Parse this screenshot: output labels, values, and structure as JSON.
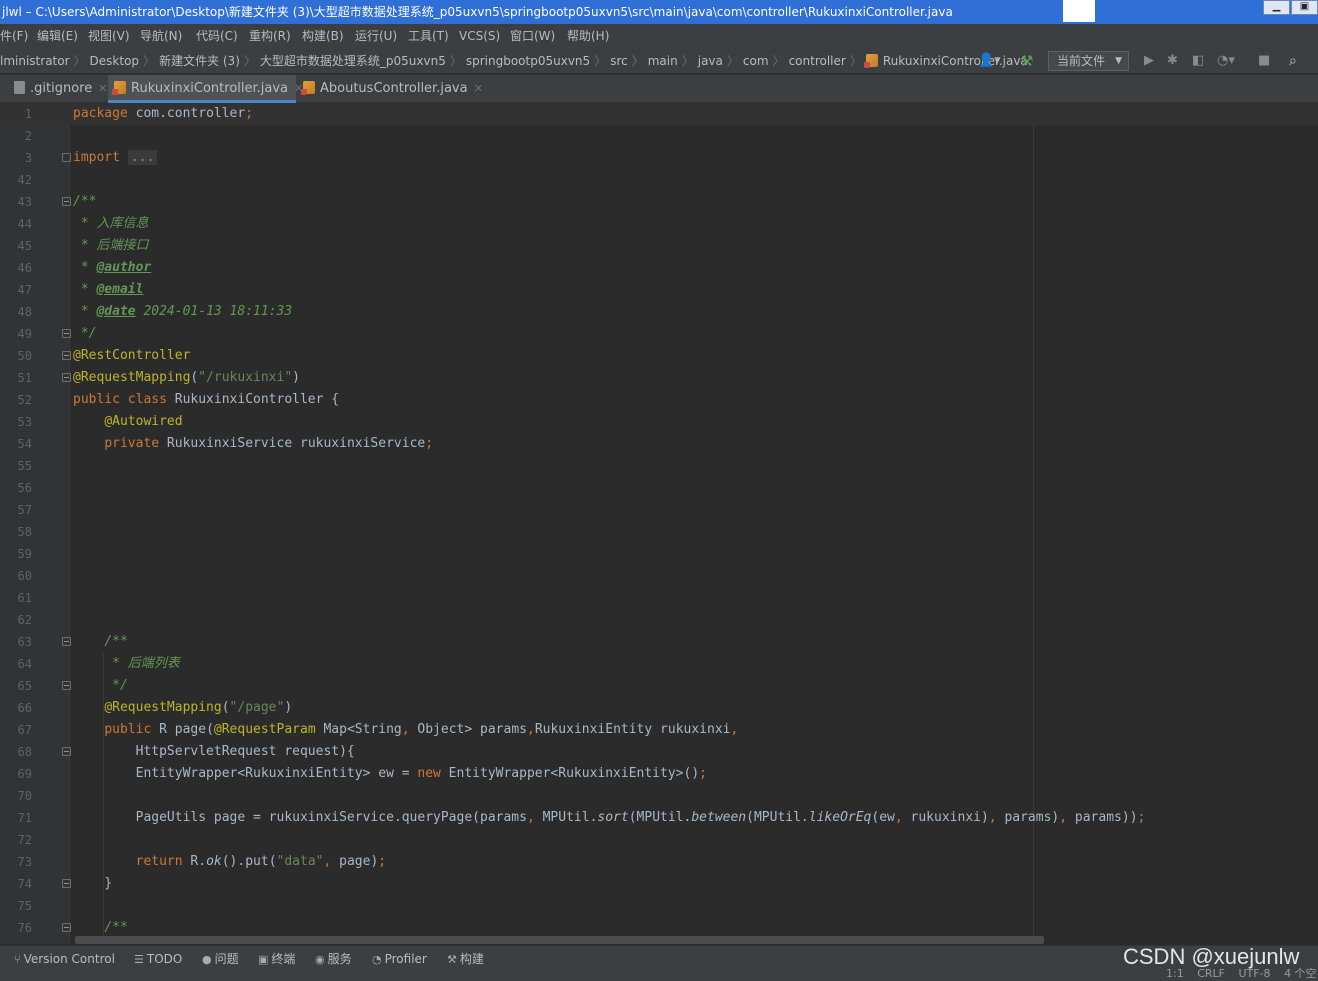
{
  "window": {
    "title": "jlwl – C:\\Users\\Administrator\\Desktop\\新建文件夹 (3)\\大型超市数据处理系统_p05uxvn5\\springbootp05uxvn5\\src\\main\\java\\com\\controller\\RukuxinxiController.java",
    "minimize": "▁",
    "restore": "▣"
  },
  "menu": [
    "件(F)",
    "编辑(E)",
    "视图(V)",
    "导航(N)",
    "代码(C)",
    "重构(R)",
    "构建(B)",
    "运行(U)",
    "工具(T)",
    "VCS(S)",
    "窗口(W)",
    "帮助(H)"
  ],
  "breadcrumbs": [
    "lministrator",
    "Desktop",
    "新建文件夹 (3)",
    "大型超市数据处理系统_p05uxvn5",
    "springbootp05uxvn5",
    "src",
    "main",
    "java",
    "com",
    "controller",
    "RukuxinxiController.java"
  ],
  "toolbar": {
    "run_config": "当前文件",
    "user_icon": "person-icon",
    "build_icon": "hammer-icon",
    "run_icon": "run-icon",
    "debug_icon": "debug-icon",
    "coverage_icon": "coverage-icon",
    "profile_icon": "profile-icon",
    "stop_icon": "stop-icon",
    "search_icon": "search-icon"
  },
  "tabs": [
    {
      "label": ".gitignore",
      "active": false
    },
    {
      "label": "RukuxinxiController.java",
      "active": true
    },
    {
      "label": "AboutusController.java",
      "active": false
    }
  ],
  "editor": {
    "lines": [
      {
        "n": "1",
        "html": "<span class=\"kw\">package</span> com.controller<span class=\"kw\">;</span>",
        "current": true
      },
      {
        "n": "2",
        "html": ""
      },
      {
        "n": "3",
        "html": "<span class=\"kw\">import</span> <span class=\"folded\">...</span>",
        "fold": "closed"
      },
      {
        "n": "42",
        "html": ""
      },
      {
        "n": "43",
        "html": "<span class=\"doc\">/**</span>",
        "fold": "open"
      },
      {
        "n": "44",
        "html": "<span class=\"doc\"> * 入库信息</span>"
      },
      {
        "n": "45",
        "html": "<span class=\"doc\"> * 后端接口</span>"
      },
      {
        "n": "46",
        "html": "<span class=\"doc\"> * </span><span class=\"tag\">@author</span>"
      },
      {
        "n": "47",
        "html": "<span class=\"doc\"> * </span><span class=\"tag\">@email</span>"
      },
      {
        "n": "48",
        "html": "<span class=\"doc\"> * </span><span class=\"tag\">@date</span><span class=\"doc\"> 2024-01-13 18:11:33</span>"
      },
      {
        "n": "49",
        "html": "<span class=\"doc\"> */</span>",
        "fold": "open"
      },
      {
        "n": "50",
        "html": "<span class=\"ann\">@RestController</span>",
        "fold": "open"
      },
      {
        "n": "51",
        "html": "<span class=\"ann\">@RequestMapping</span>(<span class=\"str\">\"/rukuxinxi\"</span>)",
        "fold": "open"
      },
      {
        "n": "52",
        "html": "<span class=\"kw\">public class</span> RukuxinxiController {"
      },
      {
        "n": "53",
        "html": "    <span class=\"ann\">@Autowired</span>"
      },
      {
        "n": "54",
        "html": "    <span class=\"kw\">private</span> RukuxinxiService rukuxinxiService<span class=\"kw\">;</span>"
      },
      {
        "n": "55",
        "html": ""
      },
      {
        "n": "56",
        "html": ""
      },
      {
        "n": "57",
        "html": ""
      },
      {
        "n": "58",
        "html": ""
      },
      {
        "n": "59",
        "html": ""
      },
      {
        "n": "60",
        "html": ""
      },
      {
        "n": "61",
        "html": ""
      },
      {
        "n": "62",
        "html": ""
      },
      {
        "n": "63",
        "html": "    <span class=\"doc\">/**</span>",
        "fold": "open"
      },
      {
        "n": "64",
        "html": "<span class=\"doc\">     * 后端列表</span>"
      },
      {
        "n": "65",
        "html": "<span class=\"doc\">     */</span>",
        "fold": "open"
      },
      {
        "n": "66",
        "html": "    <span class=\"ann\">@RequestMapping</span>(<span class=\"str\">\"/page\"</span>)"
      },
      {
        "n": "67",
        "html": "    <span class=\"kw\">public</span> R page(<span class=\"ann\">@RequestParam</span> Map&lt;String<span class=\"kw\">,</span> Object&gt; params<span class=\"kw\">,</span>RukuxinxiEntity rukuxinxi<span class=\"kw\">,</span>"
      },
      {
        "n": "68",
        "html": "        HttpServletRequest request){",
        "fold": "open"
      },
      {
        "n": "69",
        "html": "        EntityWrapper&lt;RukuxinxiEntity&gt; ew = <span class=\"kw\">new</span> EntityWrapper&lt;RukuxinxiEntity&gt;()<span class=\"kw\">;</span>"
      },
      {
        "n": "70",
        "html": ""
      },
      {
        "n": "71",
        "html": "        PageUtils page = rukuxinxiService.queryPage(params<span class=\"kw\">,</span> MPUtil.<i>sort</i>(MPUtil.<i>between</i>(MPUtil.<i>likeOrEq</i>(ew<span class=\"kw\">,</span> rukuxinxi)<span class=\"kw\">,</span> params)<span class=\"kw\">,</span> params))<span class=\"kw\">;</span>"
      },
      {
        "n": "72",
        "html": ""
      },
      {
        "n": "73",
        "html": "        <span class=\"kw\">return</span> R.<i>ok</i>().put(<span class=\"str\">\"data\"</span><span class=\"kw\">,</span> page)<span class=\"kw\">;</span>"
      },
      {
        "n": "74",
        "html": "    }",
        "fold": "open"
      },
      {
        "n": "75",
        "html": ""
      },
      {
        "n": "76",
        "html": "    <span class=\"doc\">/**</span>",
        "fold": "open"
      }
    ]
  },
  "statusbar": {
    "tools": [
      {
        "icon": "version-control-icon",
        "glyph": "⑂",
        "label": "Version Control"
      },
      {
        "icon": "todo-icon",
        "glyph": "☰",
        "label": "TODO"
      },
      {
        "icon": "problems-icon",
        "glyph": "●",
        "label": "问题"
      },
      {
        "icon": "terminal-icon",
        "glyph": "▣",
        "label": "终端"
      },
      {
        "icon": "services-icon",
        "glyph": "◉",
        "label": "服务"
      },
      {
        "icon": "profiler-icon",
        "glyph": "◔",
        "label": "Profiler"
      },
      {
        "icon": "build-icon",
        "glyph": "⚒",
        "label": "构建"
      }
    ],
    "position": "1:1",
    "line_sep": "CRLF",
    "encoding": "UTF-8",
    "indent": "4 个空"
  },
  "watermark": "CSDN @xuejunlw"
}
